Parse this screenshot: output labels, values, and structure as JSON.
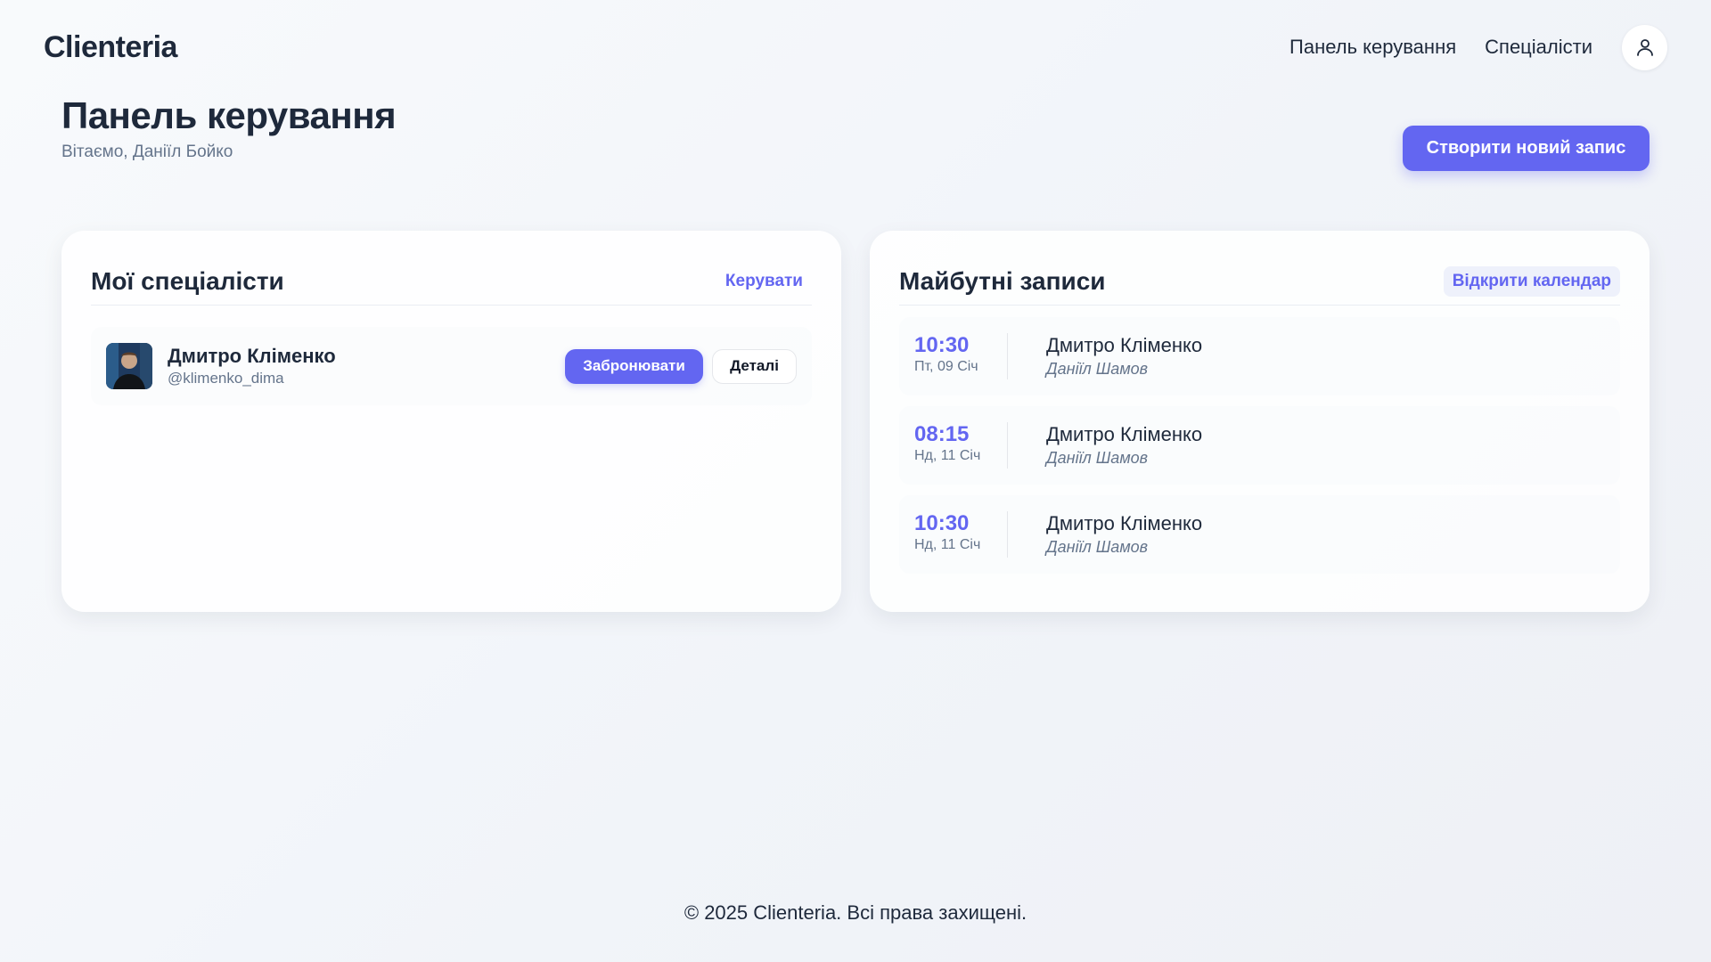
{
  "app": {
    "logo": "Clienteria"
  },
  "nav": {
    "items": [
      {
        "label": "Панель керування"
      },
      {
        "label": "Спеціалісти"
      }
    ],
    "profile_icon": "user-icon"
  },
  "page": {
    "title": "Панель керування",
    "subtitle": "Вітаємо, Даніїл Бойко",
    "create_button": "Створити новий запис"
  },
  "specialists_card": {
    "title": "Мої спеціалісти",
    "action": "Керувати",
    "items": [
      {
        "name": "Дмитро Кліменко",
        "handle": "@klimenko_dima",
        "book_label": "Забронювати",
        "details_label": "Деталі"
      }
    ]
  },
  "appointments_card": {
    "title": "Майбутні записи",
    "action": "Відкрити календар",
    "items": [
      {
        "time": "10:30",
        "date": "Пт, 09 Січ",
        "specialist": "Дмитро Кліменко",
        "client": "Даніїл Шамов"
      },
      {
        "time": "08:15",
        "date": "Нд, 11 Січ",
        "specialist": "Дмитро Кліменко",
        "client": "Даніїл Шамов"
      },
      {
        "time": "10:30",
        "date": "Нд, 11 Січ",
        "specialist": "Дмитро Кліменко",
        "client": "Даніїл Шамов"
      }
    ]
  },
  "footer": {
    "text": "© 2025 Clienteria. Всі права захищені."
  },
  "colors": {
    "accent": "#6366f1",
    "text": "#1e293b",
    "muted": "#64748b"
  }
}
